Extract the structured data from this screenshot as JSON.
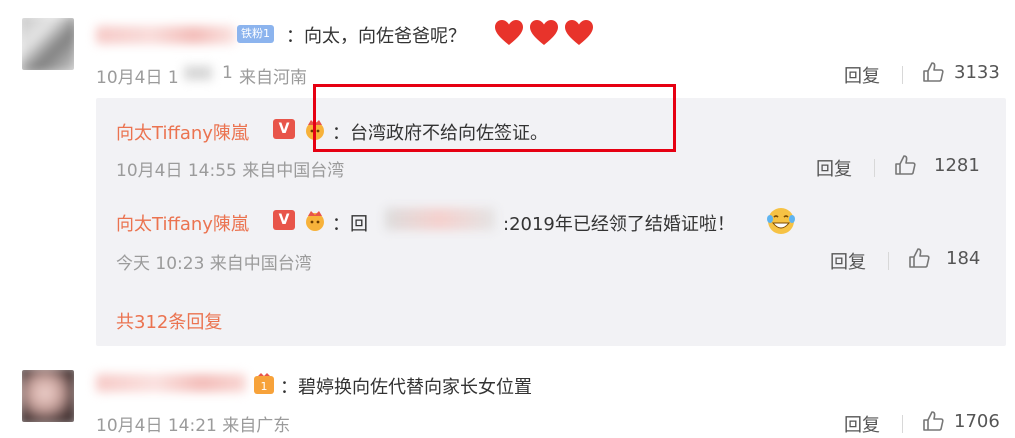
{
  "colors": {
    "accent_orange": "#eb7350",
    "meta_gray": "#9b9b9b",
    "highlight_red": "#e60012",
    "reply_bg": "#f2f2f5",
    "heart_red": "#e8332b"
  },
  "comments": [
    {
      "badge": "铁粉1",
      "text": "：向太，向佐爸爸呢？",
      "emojis": [
        "heart-icon",
        "heart-icon",
        "heart-icon"
      ],
      "date": "10月4日 1",
      "time_suffix": "1",
      "source": "来自河南",
      "reply_label": "回复",
      "likes": "3133",
      "replies": [
        {
          "author": "向太Tiffany陳嵐",
          "text": "：台湾政府不给向佐签证。",
          "meta": "10月4日 14:55 来自中国台湾",
          "reply_label": "回复",
          "likes": "1281"
        },
        {
          "author": "向太Tiffany陳嵐",
          "text_prefix": "：回",
          "text": ":2019年已经领了结婚证啦！",
          "meta": "今天 10:23 来自中国台湾",
          "reply_label": "回复",
          "likes": "184"
        }
      ],
      "more_replies": "共312条回复"
    },
    {
      "text": "：碧婷换向佐代替向家长女位置",
      "date": "10月4日 14:21 来自广东",
      "reply_label": "回复",
      "likes": "1706"
    }
  ]
}
